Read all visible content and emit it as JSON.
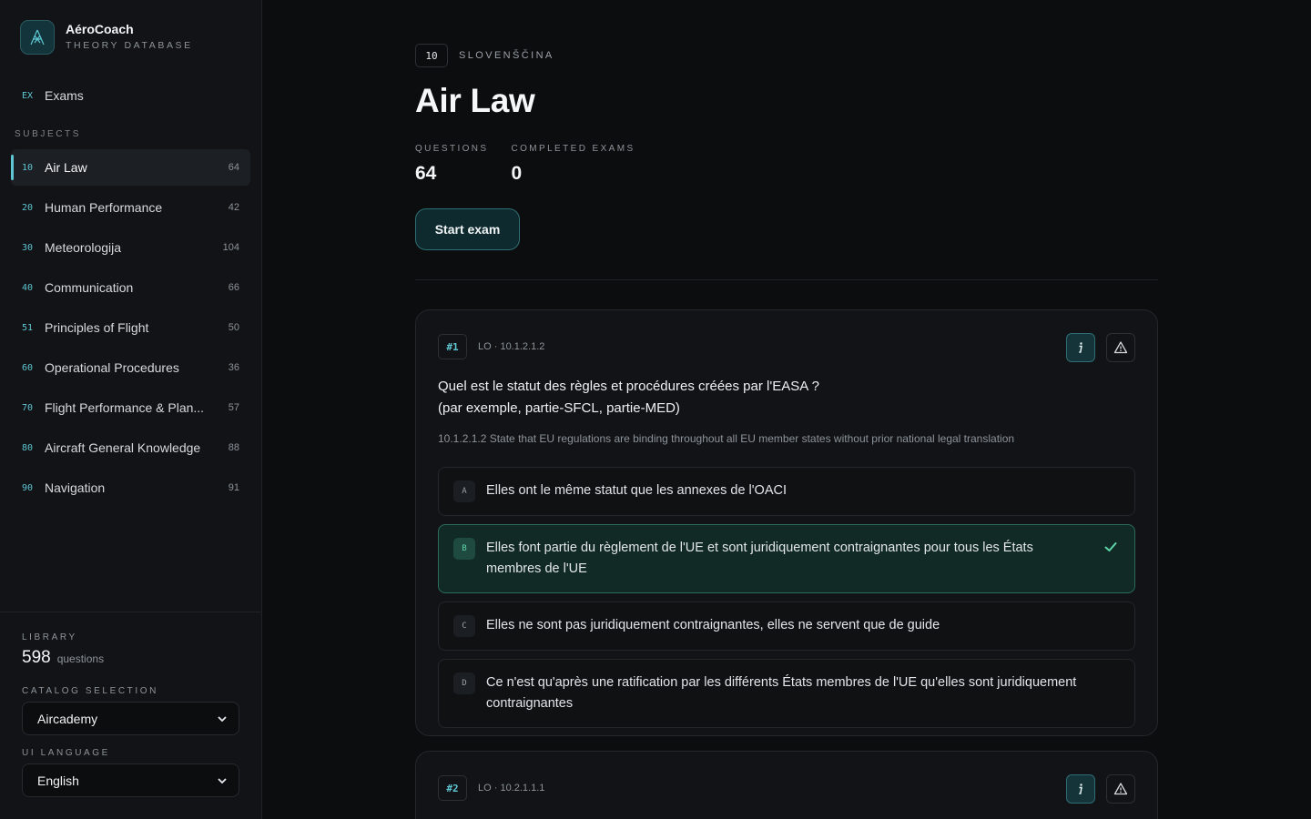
{
  "app": {
    "name": "AéroCoach",
    "subtitle": "THEORY DATABASE"
  },
  "nav": {
    "exams": {
      "code": "EX",
      "label": "Exams"
    },
    "subjects_heading": "SUBJECTS",
    "subjects": [
      {
        "code": "10",
        "label": "Air Law",
        "count": "64",
        "active": true
      },
      {
        "code": "20",
        "label": "Human Performance",
        "count": "42"
      },
      {
        "code": "30",
        "label": "Meteorologija",
        "count": "104"
      },
      {
        "code": "40",
        "label": "Communication",
        "count": "66"
      },
      {
        "code": "51",
        "label": "Principles of Flight",
        "count": "50"
      },
      {
        "code": "60",
        "label": "Operational Procedures",
        "count": "36"
      },
      {
        "code": "70",
        "label": "Flight Performance & Plan...",
        "count": "57"
      },
      {
        "code": "80",
        "label": "Aircraft General Knowledge",
        "count": "88"
      },
      {
        "code": "90",
        "label": "Navigation",
        "count": "91"
      }
    ]
  },
  "library": {
    "label": "LIBRARY",
    "count": "598",
    "unit": "questions",
    "catalog_label": "CATALOG SELECTION",
    "catalog_value": "Aircademy",
    "language_label": "UI LANGUAGE",
    "language_value": "English"
  },
  "subject": {
    "code": "10",
    "language": "SLOVENŠČINA",
    "title": "Air Law",
    "questions_label": "QUESTIONS",
    "questions_value": "64",
    "completed_label": "COMPLETED EXAMS",
    "completed_value": "0",
    "start_label": "Start exam"
  },
  "questions": [
    {
      "num": "#1",
      "lo": "LO · 10.1.2.1.2",
      "text_line1": "Quel est le statut des règles et procédures créées par l'EASA ?",
      "text_line2": "(par exemple, partie-SFCL, partie-MED)",
      "lo_desc": "10.1.2.1.2 State that EU regulations are binding throughout all EU member states without prior national legal translation",
      "answers": [
        {
          "letter": "A",
          "text": "Elles ont le même statut que les annexes de l'OACI"
        },
        {
          "letter": "B",
          "text": "Elles font partie du règlement de l'UE et sont juridiquement contraignantes pour tous les États membres de l'UE",
          "correct": true
        },
        {
          "letter": "C",
          "text": "Elles ne sont pas juridiquement contraignantes, elles ne servent que de guide"
        },
        {
          "letter": "D",
          "text": "Ce n'est qu'après une ratification par les différents États membres de l'UE qu'elles sont juridiquement contraignantes"
        }
      ]
    },
    {
      "num": "#2",
      "lo": "LO · 10.2.1.1.1"
    }
  ],
  "icons": {
    "info": "info-icon",
    "report": "warning-triangle-icon",
    "check": "check-icon",
    "logo": "aircraft-logo-icon"
  },
  "colors": {
    "accent": "#5fc6d3",
    "correct": "#5fd6a8",
    "background": "#0c0d0f"
  }
}
